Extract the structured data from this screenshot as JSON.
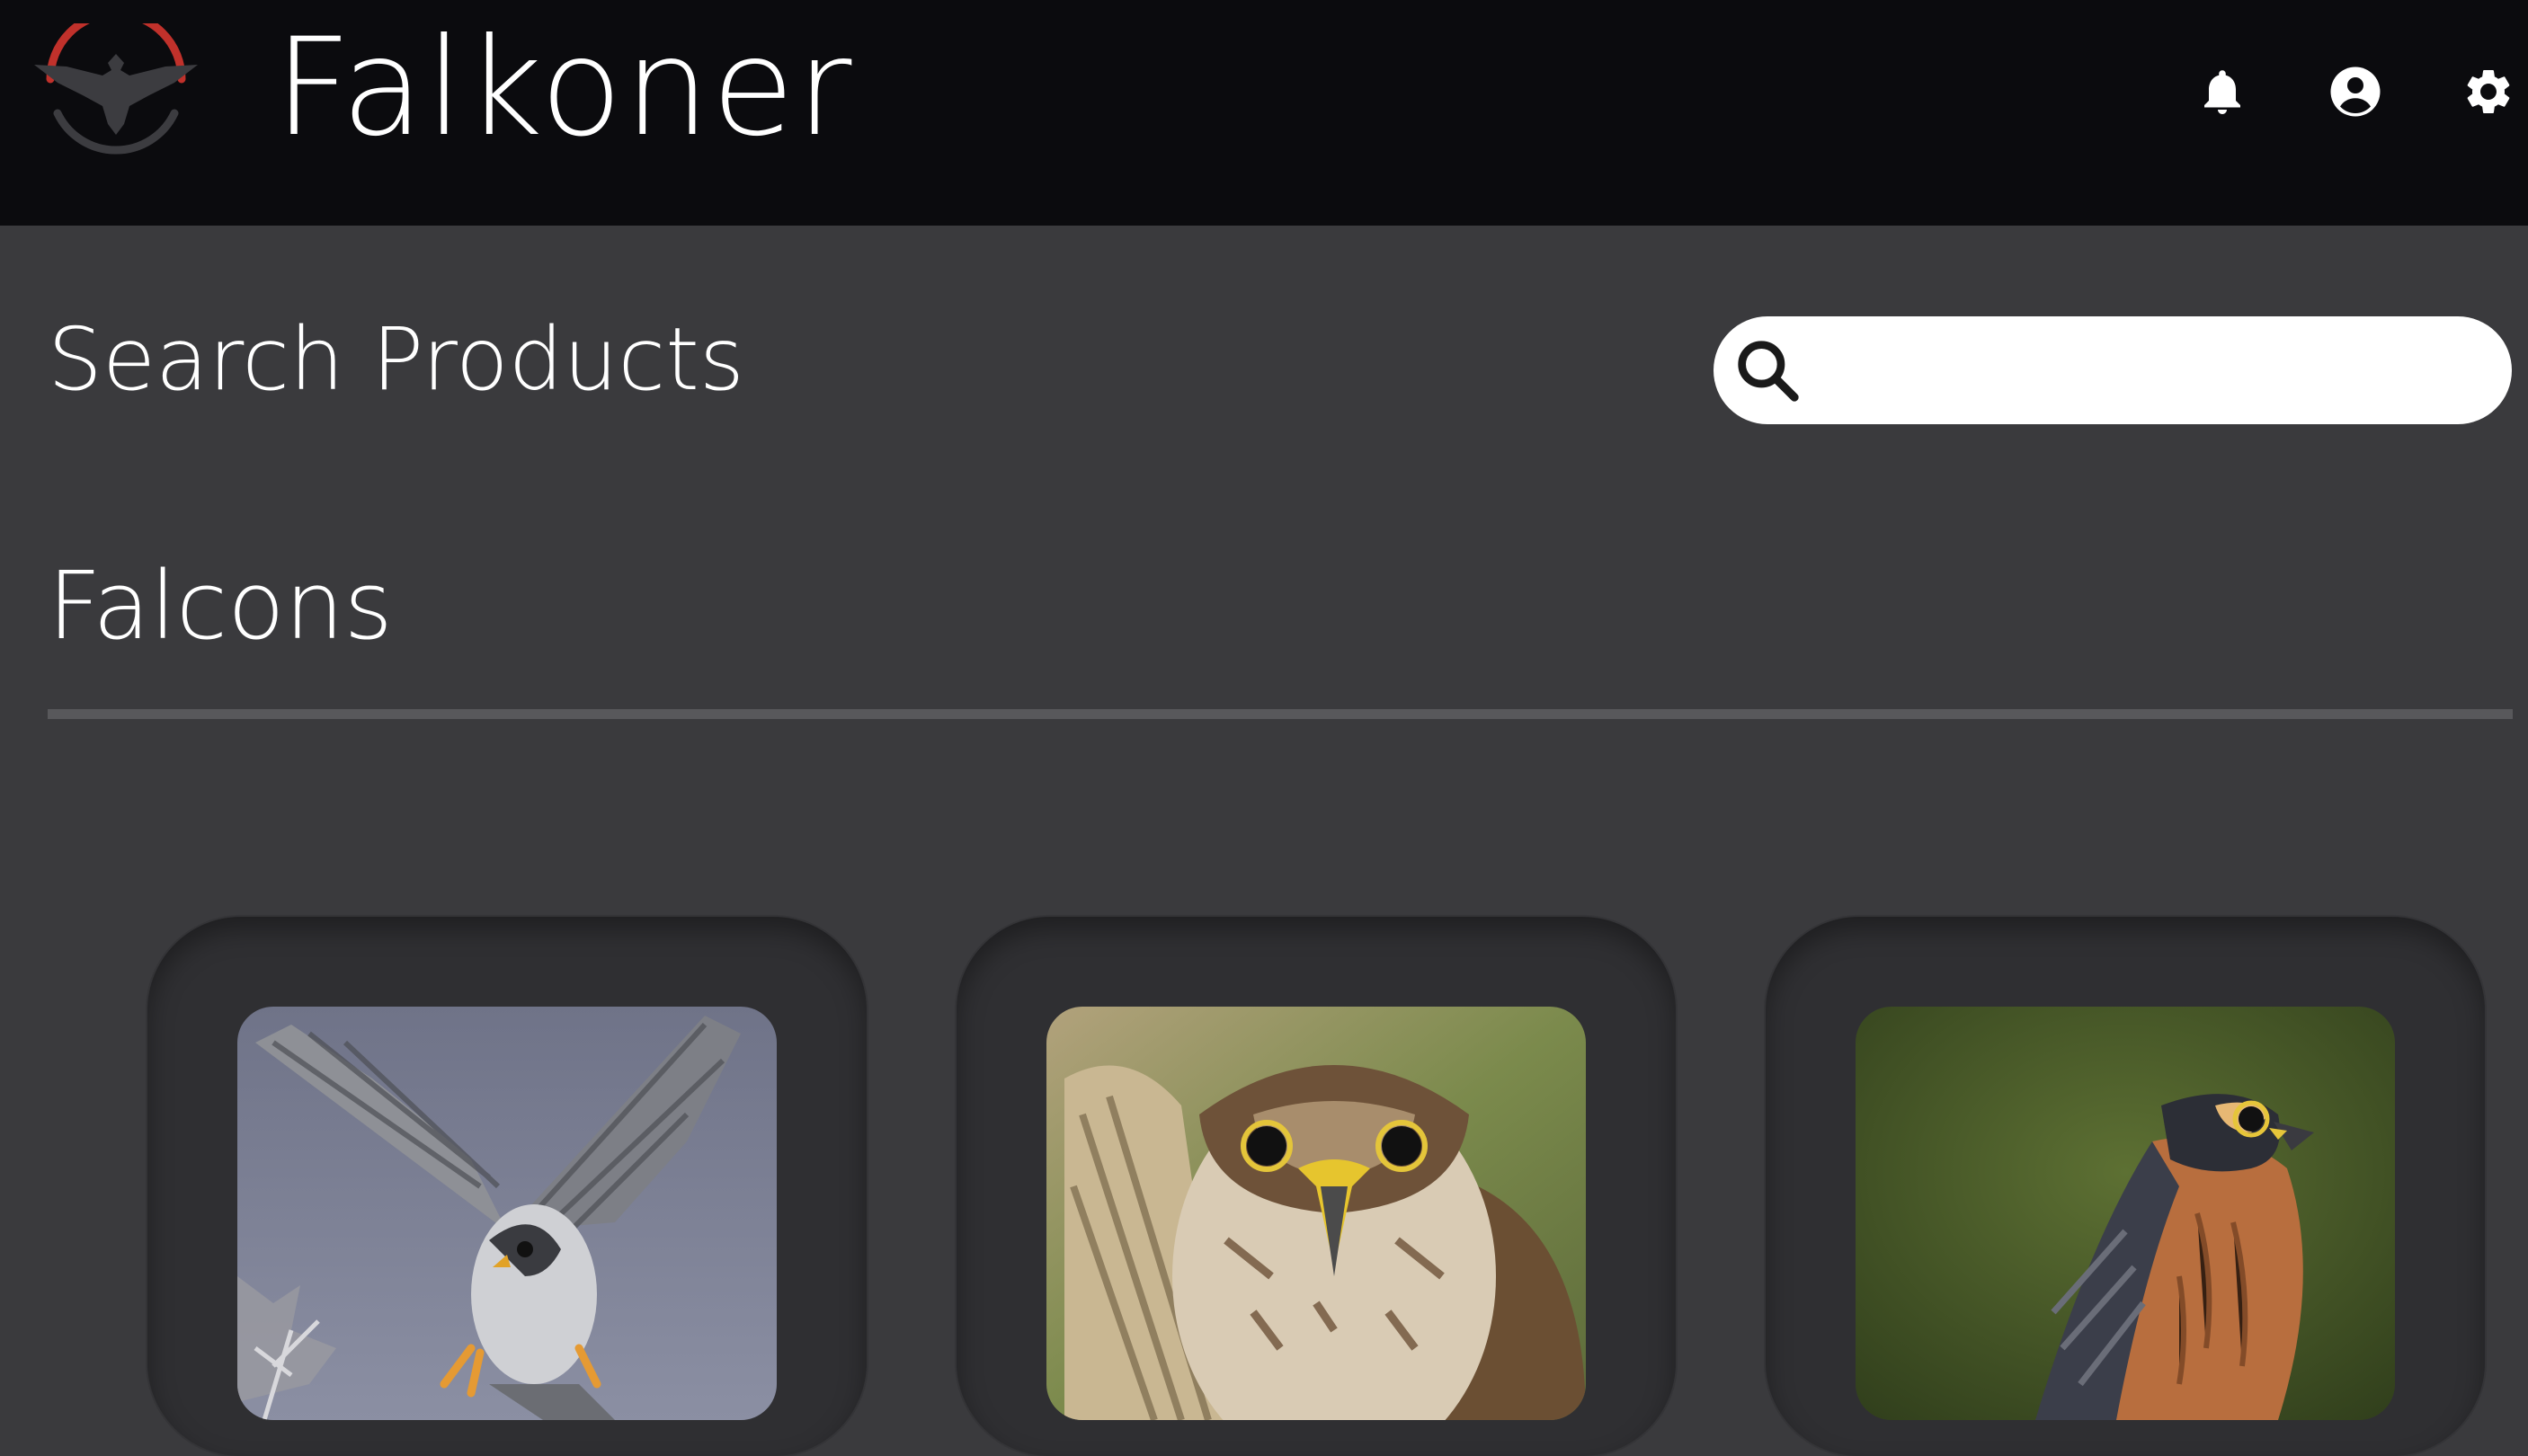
{
  "header": {
    "app_title": "Falkoner",
    "logo_icon": "falcon-emblem-icon",
    "accent_color": "#c0312b",
    "actions": [
      {
        "name": "notifications",
        "icon": "bell-icon"
      },
      {
        "name": "account",
        "icon": "user-circle-icon"
      },
      {
        "name": "settings",
        "icon": "gear-icon"
      }
    ]
  },
  "search": {
    "label": "Search Products",
    "placeholder": "",
    "value": "",
    "icon": "search-icon"
  },
  "section": {
    "title": "Falcons"
  },
  "products": [
    {
      "image": "peregrine-falcon-landing-photo"
    },
    {
      "image": "saker-falcon-closeup-photo"
    },
    {
      "image": "aplomado-falcon-perched-photo"
    }
  ]
}
